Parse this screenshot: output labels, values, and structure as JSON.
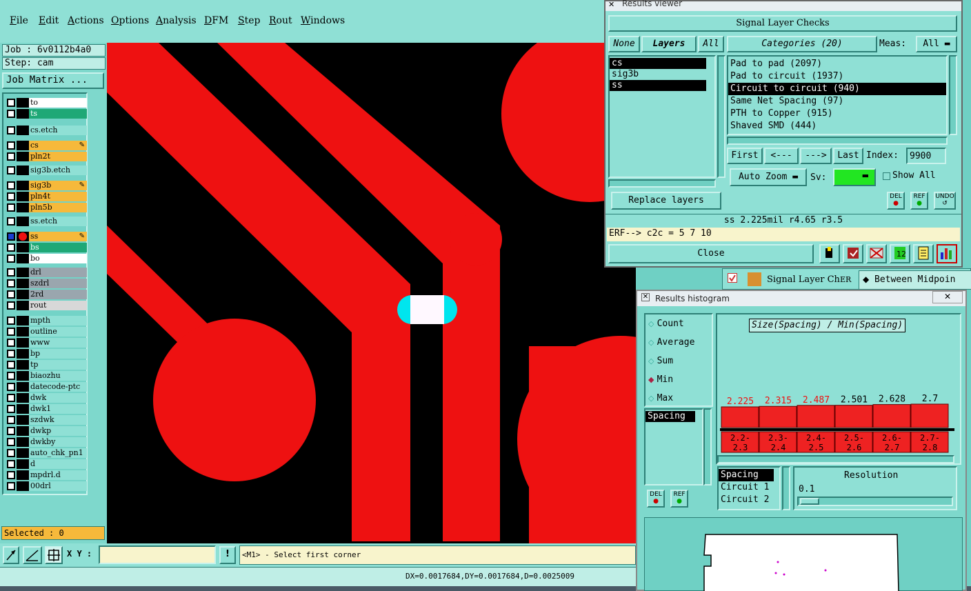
{
  "menu": [
    "File",
    "Edit",
    "Actions",
    "Options",
    "Analysis",
    "DFM",
    "Step",
    "Rout",
    "Windows"
  ],
  "job": {
    "job_line": "Job : 6v0112b4a0",
    "step_line": "Step: cam",
    "matrix_button": "Job Matrix ..."
  },
  "layers": [
    {
      "name": "to",
      "color": "#ffffff"
    },
    {
      "name": "ts",
      "color": "#1fa876"
    },
    {
      "name": "cs.etch",
      "color": "#8fe0d5"
    },
    {
      "name": "cs",
      "color": "#f6b93b",
      "mark": true
    },
    {
      "name": "pln2t",
      "color": "#f6b93b"
    },
    {
      "name": "sig3b.etch",
      "color": "#8fe0d5"
    },
    {
      "name": "sig3b",
      "color": "#f6b93b",
      "mark": true
    },
    {
      "name": "pln4t",
      "color": "#f6b93b"
    },
    {
      "name": "pln5b",
      "color": "#f6b93b"
    },
    {
      "name": "ss.etch",
      "color": "#8fe0d5"
    },
    {
      "name": "ss",
      "color": "#f6b93b",
      "mark": true,
      "active": true
    },
    {
      "name": "bs",
      "color": "#1fa876"
    },
    {
      "name": "bo",
      "color": "#ffffff"
    },
    {
      "name": "drl",
      "color": "#9aa6ae"
    },
    {
      "name": "szdrl",
      "color": "#9aa6ae"
    },
    {
      "name": "2rd",
      "color": "#9aa6ae"
    },
    {
      "name": "rout",
      "color": "#d8d8d8"
    },
    {
      "name": "mpth",
      "color": "#8fe0d5"
    },
    {
      "name": "outline",
      "color": "#8fe0d5"
    },
    {
      "name": "www",
      "color": "#8fe0d5"
    },
    {
      "name": "bp",
      "color": "#8fe0d5"
    },
    {
      "name": "tp",
      "color": "#8fe0d5"
    },
    {
      "name": "biaozhu",
      "color": "#8fe0d5"
    },
    {
      "name": "datecode-ptc",
      "color": "#8fe0d5"
    },
    {
      "name": "dwk",
      "color": "#8fe0d5"
    },
    {
      "name": "dwk1",
      "color": "#8fe0d5"
    },
    {
      "name": "szdwk",
      "color": "#8fe0d5"
    },
    {
      "name": "dwkp",
      "color": "#8fe0d5"
    },
    {
      "name": "dwkby",
      "color": "#8fe0d5"
    },
    {
      "name": "auto_chk_pn1",
      "color": "#8fe0d5"
    },
    {
      "name": "d",
      "color": "#8fe0d5"
    },
    {
      "name": "mpdrl.d",
      "color": "#8fe0d5"
    },
    {
      "name": "00drl",
      "color": "#8fe0d5"
    }
  ],
  "selected_label": "Selected : 0",
  "xy": {
    "label": "X Y :",
    "value": "",
    "prompt": "<M1> - Select first corner"
  },
  "status_coords": "DX=0.0017684,DY=0.0017684,D=0.0025009",
  "results_viewer": {
    "window_title": "Results viewer",
    "title": "Signal Layer Checks",
    "none_btn": "None",
    "layers_btn": "Layers",
    "all_btn": "All",
    "layers": [
      "cs",
      "sig3b",
      "ss"
    ],
    "categories_header": "Categories (20)",
    "meas_label": "Meas:",
    "meas_value": "All",
    "categories": [
      "Pad to pad (2097)",
      "Pad to circuit (1937)",
      "Circuit to circuit (940)",
      "Same Net Spacing (97)",
      "PTH to Copper (915)",
      "Shaved SMD (444)"
    ],
    "first_btn": "First",
    "prev_btn": "<---",
    "next_btn": "--->",
    "last_btn": "Last",
    "index_label": "Index:",
    "index_value": "9900",
    "auto_zoom": "Auto Zoom",
    "sv_label": "Sv:",
    "show_all": "Show All",
    "replace_layers": "Replace layers",
    "del": "DEL",
    "ref": "REF",
    "undo": "UNDO",
    "measure_line": "ss 2.225mil  r4.65  r3.5",
    "erf_line": "ERF--> c2c = 5 7 10",
    "close": "Close"
  },
  "task_strip": {
    "item": "Signal Layer Ch",
    "er": "ER",
    "between": "Between Midpoin"
  },
  "histogram": {
    "window_title": "Results histogram",
    "options": [
      "Count",
      "Average",
      "Sum",
      "Min",
      "Max"
    ],
    "selected_option": "Min",
    "left_list": [
      "Spacing"
    ],
    "chart_title": "Size(Spacing) / Min(Spacing)",
    "resolution_label": "Resolution",
    "resolution_value": "0.1",
    "bottom_list": [
      "Spacing",
      "Circuit 1",
      "Circuit 2"
    ],
    "del": "DEL",
    "ref": "REF"
  },
  "chart_data": {
    "type": "bar",
    "title": "Size(Spacing) / Min(Spacing)",
    "categories": [
      "2.2-2.3",
      "2.3-2.4",
      "2.4-2.5",
      "2.5-2.6",
      "2.6-2.7",
      "2.7-2.8"
    ],
    "category_lines": [
      [
        "2.2-",
        "2.3"
      ],
      [
        "2.3-",
        "2.4"
      ],
      [
        "2.4-",
        "2.5"
      ],
      [
        "2.5-",
        "2.6"
      ],
      [
        "2.6-",
        "2.7"
      ],
      [
        "2.7-",
        "2.8"
      ]
    ],
    "values": [
      2.225,
      2.315,
      2.487,
      2.501,
      2.628,
      2.7
    ],
    "value_labels": [
      "2.225",
      "2.315",
      "2.487",
      "2.501",
      "2.628",
      "2.7"
    ],
    "label_colors": [
      "#e11",
      "#e11",
      "#e11",
      "#000",
      "#000",
      "#000"
    ],
    "bar_color": "#ee2222"
  }
}
